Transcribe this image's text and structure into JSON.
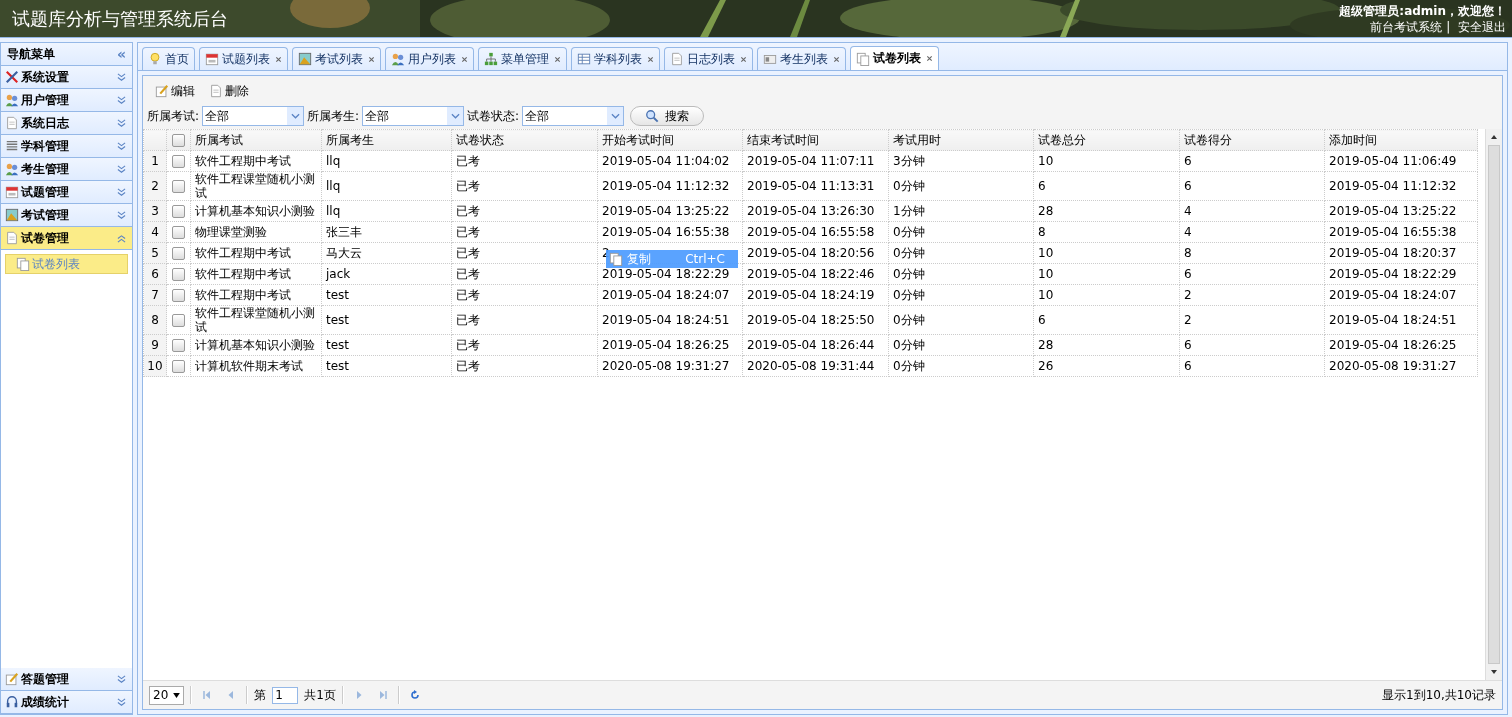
{
  "header": {
    "title": "试题库分析与管理系统后台",
    "welcome": "超级管理员:admin，欢迎您！",
    "separator": "|",
    "links": [
      "前台考试系统",
      "安全退出"
    ]
  },
  "sidebar": {
    "title": "导航菜单",
    "collapse": "«",
    "groups": [
      {
        "label": "系统设置",
        "expanded": false
      },
      {
        "label": "用户管理",
        "expanded": false
      },
      {
        "label": "系统日志",
        "expanded": false
      },
      {
        "label": "学科管理",
        "expanded": false
      },
      {
        "label": "考生管理",
        "expanded": false
      },
      {
        "label": "试题管理",
        "expanded": false
      },
      {
        "label": "考试管理",
        "expanded": false
      },
      {
        "label": "试卷管理",
        "expanded": true,
        "children": [
          {
            "label": "试卷列表",
            "selected": true
          }
        ]
      }
    ],
    "bottom_groups": [
      {
        "label": "答题管理",
        "expanded": false
      },
      {
        "label": "成绩统计",
        "expanded": false
      }
    ]
  },
  "tabs": [
    {
      "label": "首页",
      "closable": false,
      "selected": false
    },
    {
      "label": "试题列表",
      "closable": true,
      "selected": false
    },
    {
      "label": "考试列表",
      "closable": true,
      "selected": false
    },
    {
      "label": "用户列表",
      "closable": true,
      "selected": false
    },
    {
      "label": "菜单管理",
      "closable": true,
      "selected": false
    },
    {
      "label": "学科列表",
      "closable": true,
      "selected": false
    },
    {
      "label": "日志列表",
      "closable": true,
      "selected": false
    },
    {
      "label": "考生列表",
      "closable": true,
      "selected": false
    },
    {
      "label": "试卷列表",
      "closable": true,
      "selected": true
    }
  ],
  "toolbar": [
    "编辑",
    "删除"
  ],
  "filters": [
    {
      "label": "所属考试:",
      "value": "全部"
    },
    {
      "label": "所属考生:",
      "value": "全部"
    },
    {
      "label": "试卷状态:",
      "value": "全部"
    }
  ],
  "search_button": "搜索",
  "table": {
    "header_checked": false,
    "columns": [
      "所属考试",
      "所属考生",
      "试卷状态",
      "开始考试时间",
      "结束考试时间",
      "考试用时",
      "试卷总分",
      "试卷得分",
      "添加时间"
    ],
    "rows": [
      {
        "n": "1",
        "checked": false,
        "cells": [
          "软件工程期中考试",
          "llq",
          "已考",
          "2019-05-04 11:04:02",
          "2019-05-04 11:07:11",
          "3分钟",
          "10",
          "6",
          "2019-05-04 11:06:49"
        ]
      },
      {
        "n": "2",
        "checked": false,
        "cells": [
          "软件工程课堂随机小测试",
          "llq",
          "已考",
          "2019-05-04 11:12:32",
          "2019-05-04 11:13:31",
          "0分钟",
          "6",
          "6",
          "2019-05-04 11:12:32"
        ]
      },
      {
        "n": "3",
        "checked": false,
        "cells": [
          "计算机基本知识小测验",
          "llq",
          "已考",
          "2019-05-04 13:25:22",
          "2019-05-04 13:26:30",
          "1分钟",
          "28",
          "4",
          "2019-05-04 13:25:22"
        ]
      },
      {
        "n": "4",
        "checked": false,
        "cells": [
          "物理课堂测验",
          "张三丰",
          "已考",
          "2019-05-04 16:55:38",
          "2019-05-04 16:55:58",
          "0分钟",
          "8",
          "4",
          "2019-05-04 16:55:38"
        ]
      },
      {
        "n": "5",
        "checked": false,
        "cells": [
          "软件工程期中考试",
          "马大云",
          "已考",
          "2",
          "2019-05-04 18:20:56",
          "0分钟",
          "10",
          "8",
          "2019-05-04 18:20:37"
        ]
      },
      {
        "n": "6",
        "checked": false,
        "cells": [
          "软件工程期中考试",
          "jack",
          "已考",
          "2019-05-04 18:22:29",
          "2019-05-04 18:22:46",
          "0分钟",
          "10",
          "6",
          "2019-05-04 18:22:29"
        ]
      },
      {
        "n": "7",
        "checked": false,
        "cells": [
          "软件工程期中考试",
          "test",
          "已考",
          "2019-05-04 18:24:07",
          "2019-05-04 18:24:19",
          "0分钟",
          "10",
          "2",
          "2019-05-04 18:24:07"
        ]
      },
      {
        "n": "8",
        "checked": false,
        "cells": [
          "软件工程课堂随机小测试",
          "test",
          "已考",
          "2019-05-04 18:24:51",
          "2019-05-04 18:25:50",
          "0分钟",
          "6",
          "2",
          "2019-05-04 18:24:51"
        ]
      },
      {
        "n": "9",
        "checked": false,
        "cells": [
          "计算机基本知识小测验",
          "test",
          "已考",
          "2019-05-04 18:26:25",
          "2019-05-04 18:26:44",
          "0分钟",
          "28",
          "6",
          "2019-05-04 18:26:25"
        ]
      },
      {
        "n": "10",
        "checked": false,
        "cells": [
          "计算机软件期末考试",
          "test",
          "已考",
          "2020-05-08 19:31:27",
          "2020-05-08 19:31:44",
          "0分钟",
          "26",
          "6",
          "2020-05-08 19:31:27"
        ]
      }
    ]
  },
  "context_menu": [
    {
      "label": "复制",
      "shortcut": "Ctrl+C"
    }
  ],
  "pager": {
    "page_size": "20",
    "page_label": "第",
    "page": "1",
    "total_pages": "共1页",
    "info": "显示1到10,共10记录"
  }
}
